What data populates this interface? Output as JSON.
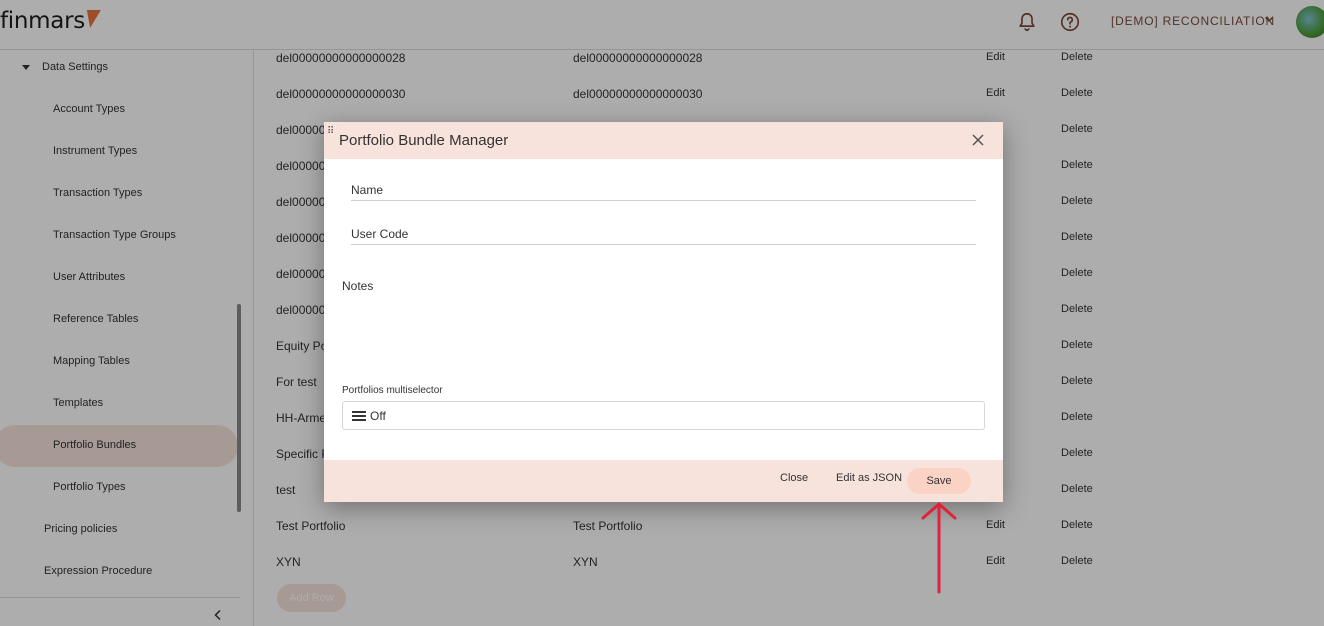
{
  "header": {
    "logo_text": "finmars",
    "space_name": "[DEMO] RECONCILIATION",
    "icons": [
      "bell-icon",
      "help-icon",
      "chevron-down-icon"
    ]
  },
  "sidebar": {
    "section_label": "Data Settings",
    "items": [
      {
        "label": "Account Types",
        "active": false
      },
      {
        "label": "Instrument Types",
        "active": false
      },
      {
        "label": "Transaction Types",
        "active": false
      },
      {
        "label": "Transaction Type Groups",
        "active": false
      },
      {
        "label": "User Attributes",
        "active": false
      },
      {
        "label": "Reference Tables",
        "active": false
      },
      {
        "label": "Mapping Tables",
        "active": false
      },
      {
        "label": "Templates",
        "active": false
      },
      {
        "label": "Portfolio Bundles",
        "active": true
      },
      {
        "label": "Portfolio Types",
        "active": false
      }
    ],
    "top_items": [
      {
        "label": "Pricing policies"
      },
      {
        "label": "Expression Procedure"
      }
    ]
  },
  "table": {
    "rows": [
      {
        "name": "del00000000000000028",
        "user_code": "del00000000000000028",
        "edit": "Edit",
        "delete": "Delete"
      },
      {
        "name": "del00000000000000030",
        "user_code": "del00000000000000030",
        "edit": "Edit",
        "delete": "Delete"
      },
      {
        "name": "del000000",
        "user_code": "",
        "edit": "",
        "delete": "Delete"
      },
      {
        "name": "del000000",
        "user_code": "",
        "edit": "",
        "delete": "Delete"
      },
      {
        "name": "del000000",
        "user_code": "",
        "edit": "",
        "delete": "Delete"
      },
      {
        "name": "del000000",
        "user_code": "",
        "edit": "",
        "delete": "Delete"
      },
      {
        "name": "del000000",
        "user_code": "",
        "edit": "",
        "delete": "Delete"
      },
      {
        "name": "del000000",
        "user_code": "",
        "edit": "",
        "delete": "Delete"
      },
      {
        "name": "Equity Po",
        "user_code": "",
        "edit": "",
        "delete": "Delete"
      },
      {
        "name": "For test",
        "user_code": "",
        "edit": "",
        "delete": "Delete"
      },
      {
        "name": "HH-Arme",
        "user_code": "",
        "edit": "",
        "delete": "Delete"
      },
      {
        "name": "Specific P",
        "user_code": "",
        "edit": "",
        "delete": "Delete"
      },
      {
        "name": "test",
        "user_code": "",
        "edit": "",
        "delete": "Delete"
      },
      {
        "name": "Test Portfolio",
        "user_code": "Test Portfolio",
        "edit": "Edit",
        "delete": "Delete"
      },
      {
        "name": "XYN",
        "user_code": "XYN",
        "edit": "Edit",
        "delete": "Delete"
      }
    ],
    "add_row_label": "Add Row"
  },
  "dialog": {
    "title": "Portfolio Bundle Manager",
    "name_label": "Name",
    "user_code_label": "User Code",
    "notes_label": "Notes",
    "multiselector_label": "Portfolios multiselector",
    "multiselector_value": "Off",
    "footer": {
      "close_label": "Close",
      "edit_json_label": "Edit as JSON",
      "save_label": "Save"
    }
  },
  "colors": {
    "accent": "#f7e3db",
    "save_button": "#fbd3c4",
    "logo_mark": "#e8743b",
    "annotation_arrow": "#e0233a"
  }
}
